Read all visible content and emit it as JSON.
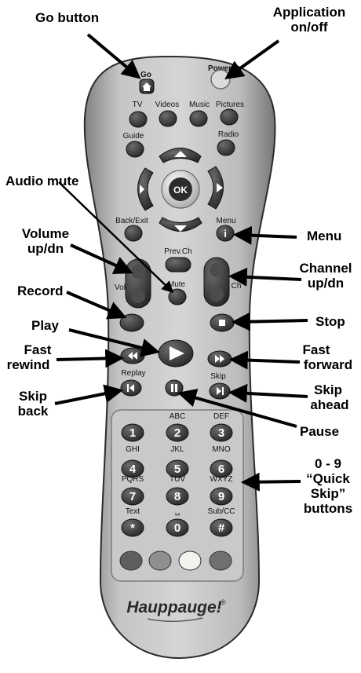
{
  "callouts": {
    "go_button": "Go button",
    "application_onoff_line1": "Application",
    "application_onoff_line2": "on/off",
    "audio_mute": "Audio mute",
    "volume_line1": "Volume",
    "volume_line2": "up/dn",
    "menu": "Menu",
    "channel_line1": "Channel",
    "channel_line2": "up/dn",
    "record": "Record",
    "play": "Play",
    "stop": "Stop",
    "fast_rewind_line1": "Fast",
    "fast_rewind_line2": "rewind",
    "fast_forward_line1": "Fast",
    "fast_forward_line2": "forward",
    "skip_back_line1": "Skip",
    "skip_back_line2": "back",
    "skip_ahead_line1": "Skip",
    "skip_ahead_line2": "ahead",
    "pause": "Pause",
    "quick_skip_line1": "0 - 9",
    "quick_skip_line2": "“Quick",
    "quick_skip_line3": "Skip”",
    "quick_skip_line4": "buttons"
  },
  "remote": {
    "labels": {
      "go": "Go",
      "power": "Power",
      "tv": "TV",
      "videos": "Videos",
      "music": "Music",
      "pictures": "Pictures",
      "guide": "Guide",
      "radio": "Radio",
      "ok": "OK",
      "back_exit": "Back/Exit",
      "menu": "Menu",
      "menu_glyph": "i",
      "prev_ch": "Prev.Ch",
      "vol": "Vol",
      "ch": "Ch",
      "mute": "Mute",
      "replay": "Replay",
      "skip": "Skip",
      "brand": "Hauppauge!",
      "registered": "®"
    },
    "keypad": [
      {
        "num": "1",
        "letters": ""
      },
      {
        "num": "2",
        "letters": "ABC"
      },
      {
        "num": "3",
        "letters": "DEF"
      },
      {
        "num": "4",
        "letters": "GHI"
      },
      {
        "num": "5",
        "letters": "JKL"
      },
      {
        "num": "6",
        "letters": "MNO"
      },
      {
        "num": "7",
        "letters": "PQRS"
      },
      {
        "num": "8",
        "letters": "TUV"
      },
      {
        "num": "9",
        "letters": "WXYZ"
      },
      {
        "num": "*",
        "letters": "Text"
      },
      {
        "num": "0",
        "letters": "␣"
      },
      {
        "num": "#",
        "letters": "Sub/CC"
      }
    ],
    "colors": {
      "body": "#a7a9ab",
      "body_light": "#d4d6d8",
      "button": "#3d3f41",
      "panel": "#bfc1c3",
      "color_buttons": [
        "#5c5e60",
        "#8d8f91",
        "#f2f2ee",
        "#6e7072"
      ]
    }
  }
}
